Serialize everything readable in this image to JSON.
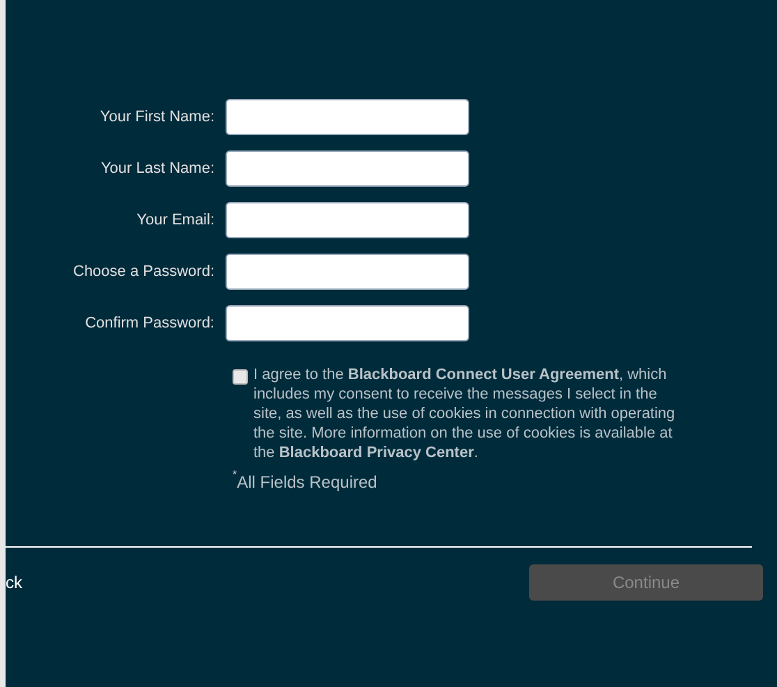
{
  "fields": [
    {
      "label": "Your First Name:"
    },
    {
      "label": "Your Last Name:"
    },
    {
      "label": "Your Email:"
    },
    {
      "label": "Choose a Password:"
    },
    {
      "label": "Confirm Password:"
    }
  ],
  "agreement": {
    "checked": false,
    "text": "I agree to the **Blackboard Connect User Agreement**, which includes my consent to receive the messages I select in the site, as well as the use of cookies in connection with operating the site. More information on the use of cookies is available at the **Blackboard Privacy Center**."
  },
  "required_note": {
    "mark": "*",
    "text": "All Fields Required"
  },
  "footer": {
    "back": "ck",
    "continue": {
      "label": "Continue",
      "disabled": true
    }
  }
}
